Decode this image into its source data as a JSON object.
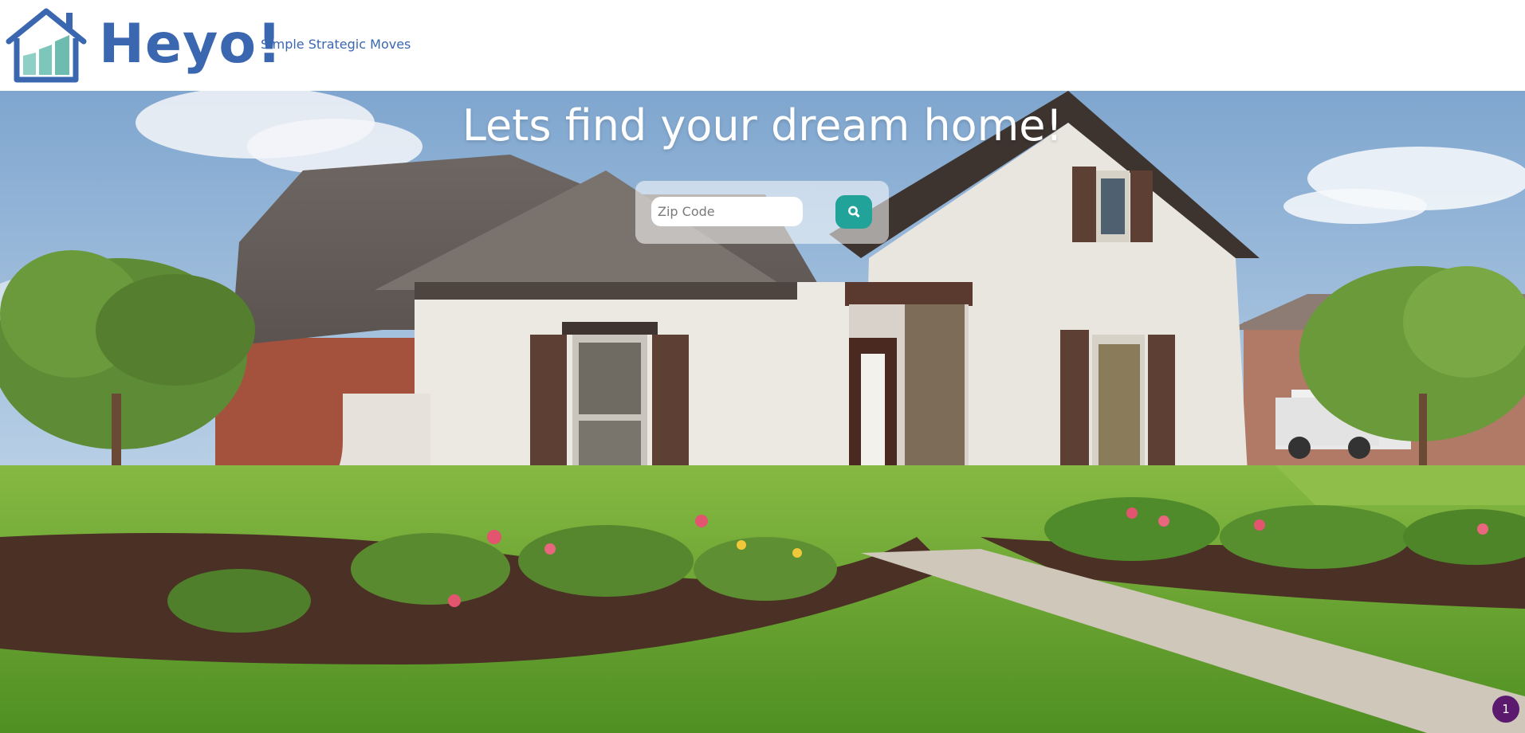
{
  "header": {
    "brand": "Heyo!",
    "tagline": "Simple Strategic Moves",
    "logo_icon": "house-chart-icon"
  },
  "hero": {
    "title": "Lets find your dream home!",
    "background": "house-photo"
  },
  "search": {
    "zip_placeholder": "Zip Code",
    "zip_value": "",
    "button_icon": "search-icon"
  },
  "notification": {
    "count": "1"
  },
  "colors": {
    "brand": "#3a67b0",
    "accent": "#22a39a",
    "badge": "#5b1a6e"
  }
}
